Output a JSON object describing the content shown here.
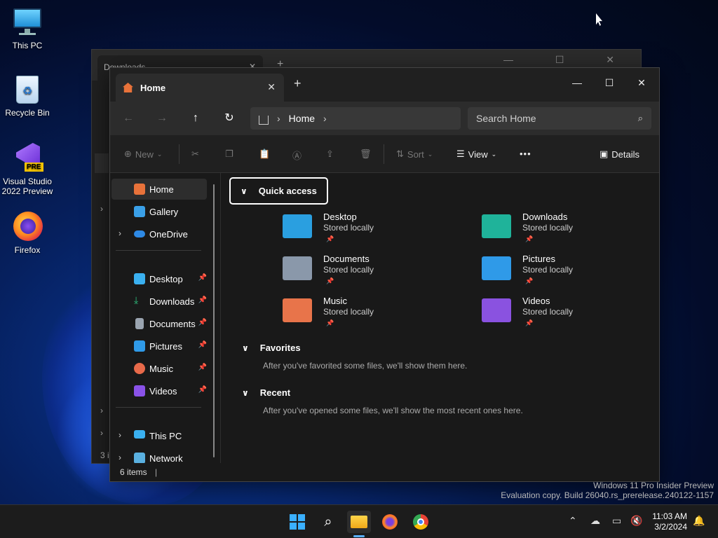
{
  "desktop": {
    "icons": [
      {
        "label": "This PC"
      },
      {
        "label": "Recycle Bin"
      },
      {
        "label": "Visual Studio 2022 Preview",
        "badge": "PRE"
      },
      {
        "label": "Firefox"
      }
    ]
  },
  "bg_window": {
    "tab_label": "Downloads",
    "status": "3 i"
  },
  "window": {
    "tab_label": "Home",
    "new_tab": "+",
    "controls": {
      "minimize": "—",
      "maximize": "☐",
      "close": "✕"
    },
    "address": {
      "crumb": "Home"
    },
    "search": {
      "placeholder": "Search Home"
    },
    "commands": {
      "new": "New",
      "sort": "Sort",
      "view": "View",
      "more": "•••",
      "details": "Details"
    },
    "sidebar": {
      "top": [
        {
          "label": "Home",
          "color": "#e8723a"
        },
        {
          "label": "Gallery",
          "color": "#3aa0e8"
        },
        {
          "label": "OneDrive",
          "color": "#2e8ae6"
        }
      ],
      "pinned": [
        {
          "label": "Desktop",
          "color": "#3ab0f0"
        },
        {
          "label": "Downloads",
          "color": "#2ec27e"
        },
        {
          "label": "Documents",
          "color": "#9aa4b0"
        },
        {
          "label": "Pictures",
          "color": "#2f9ae8"
        },
        {
          "label": "Music",
          "color": "#e86a4a"
        },
        {
          "label": "Videos",
          "color": "#8a52e8"
        }
      ],
      "bottom": [
        {
          "label": "This PC",
          "color": "#3ab0f0"
        },
        {
          "label": "Network",
          "color": "#5ab0e0"
        }
      ]
    },
    "quick_access": {
      "title": "Quick access",
      "folders": [
        {
          "name": "Desktop",
          "sub": "Stored locally",
          "color": "#2a9fe0"
        },
        {
          "name": "Downloads",
          "sub": "Stored locally",
          "color": "#1fb39a"
        },
        {
          "name": "Documents",
          "sub": "Stored locally",
          "color": "#8a98aa"
        },
        {
          "name": "Pictures",
          "sub": "Stored locally",
          "color": "#2f9ae8"
        },
        {
          "name": "Music",
          "sub": "Stored locally",
          "color": "#e8744a"
        },
        {
          "name": "Videos",
          "sub": "Stored locally",
          "color": "#8a52e0"
        }
      ]
    },
    "favorites": {
      "title": "Favorites",
      "message": "After you've favorited some files, we'll show them here."
    },
    "recent": {
      "title": "Recent",
      "message": "After you've opened some files, we'll show the most recent ones here."
    },
    "status": "6 items"
  },
  "watermark": {
    "line1": "Windows 11 Pro Insider Preview",
    "line2": "Evaluation copy. Build 26040.rs_prerelease.240122-1157"
  },
  "taskbar": {
    "time": "11:03 AM",
    "date": "3/2/2024"
  }
}
